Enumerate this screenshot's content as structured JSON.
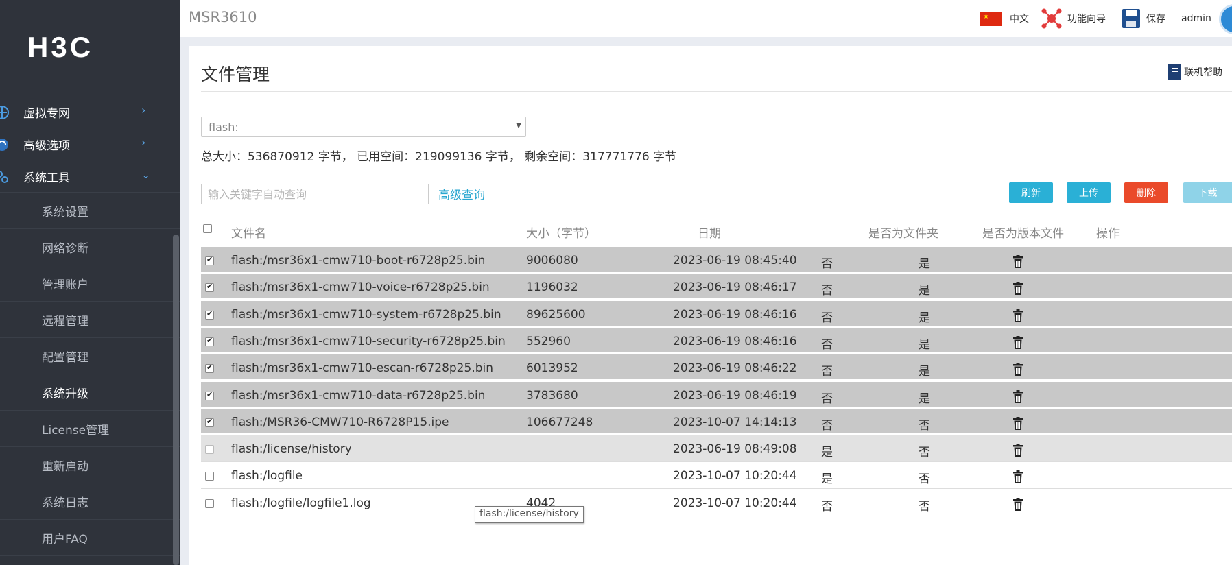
{
  "app": {
    "device": "MSR3610",
    "logo": "H3C"
  },
  "topbar": {
    "language": "中文",
    "wizard": "功能向导",
    "save": "保存",
    "user": "admin"
  },
  "sidebar": {
    "items": [
      {
        "label": "虚拟专网",
        "icon": "vpn-icon"
      },
      {
        "label": "高级选项",
        "icon": "advanced-icon"
      },
      {
        "label": "系统工具",
        "icon": "tools-icon"
      }
    ],
    "sub_items": [
      {
        "label": "系统设置"
      },
      {
        "label": "网络诊断"
      },
      {
        "label": "管理账户"
      },
      {
        "label": "远程管理"
      },
      {
        "label": "配置管理"
      },
      {
        "label": "系统升级",
        "active": true
      },
      {
        "label": "License管理"
      },
      {
        "label": "重新启动"
      },
      {
        "label": "系统日志"
      },
      {
        "label": "用户FAQ"
      }
    ]
  },
  "page": {
    "title": "文件管理",
    "help": "联机帮助",
    "storage_select": "flash:",
    "summary": "总大小：536870912 字节， 已用空间：219099136 字节， 剩余空间：317771776 字节",
    "search_placeholder": "输入关键字自动查询",
    "advanced_search": "高级查询"
  },
  "buttons": {
    "refresh": "刷新",
    "upload": "上传",
    "delete": "删除",
    "download": "下载"
  },
  "colors": {
    "refresh": "#2ab0d6",
    "upload": "#2ab0d6",
    "delete": "#ea4a2a",
    "download": "#8fd3e8"
  },
  "table": {
    "headers": [
      "文件名",
      "大小（字节）",
      "日期",
      "是否为文件夹",
      "是否为版本文件",
      "操作"
    ],
    "rows": [
      {
        "name": "flash:/msr36x1-cmw710-boot-r6728p25.bin",
        "size": "9006080",
        "date": "2023-06-19 08:45:40",
        "folder": "否",
        "version": "是",
        "checked": true
      },
      {
        "name": "flash:/msr36x1-cmw710-voice-r6728p25.bin",
        "size": "1196032",
        "date": "2023-06-19 08:46:17",
        "folder": "否",
        "version": "是",
        "checked": true
      },
      {
        "name": "flash:/msr36x1-cmw710-system-r6728p25.bin",
        "size": "89625600",
        "date": "2023-06-19 08:46:16",
        "folder": "否",
        "version": "是",
        "checked": true
      },
      {
        "name": "flash:/msr36x1-cmw710-security-r6728p25.bin",
        "size": "552960",
        "date": "2023-06-19 08:46:16",
        "folder": "否",
        "version": "是",
        "checked": true
      },
      {
        "name": "flash:/msr36x1-cmw710-escan-r6728p25.bin",
        "size": "6013952",
        "date": "2023-06-19 08:46:22",
        "folder": "否",
        "version": "是",
        "checked": true
      },
      {
        "name": "flash:/msr36x1-cmw710-data-r6728p25.bin",
        "size": "3783680",
        "date": "2023-06-19 08:46:19",
        "folder": "否",
        "version": "是",
        "checked": true
      },
      {
        "name": "flash:/MSR36-CMW710-R6728P15.ipe",
        "size": "106677248",
        "date": "2023-10-07 14:14:13",
        "folder": "否",
        "version": "否",
        "checked": true
      },
      {
        "name": "flash:/license/history",
        "size": "",
        "date": "2023-06-19 08:49:08",
        "folder": "是",
        "version": "否",
        "checked": false
      },
      {
        "name": "flash:/logfile",
        "size": "",
        "date": "2023-10-07 10:20:44",
        "folder": "是",
        "version": "否",
        "checked": false
      },
      {
        "name": "flash:/logfile/logfile1.log",
        "size": "4042",
        "date": "2023-10-07 10:20:44",
        "folder": "否",
        "version": "否",
        "checked": false
      }
    ]
  },
  "tooltip": "flash:/license/history"
}
